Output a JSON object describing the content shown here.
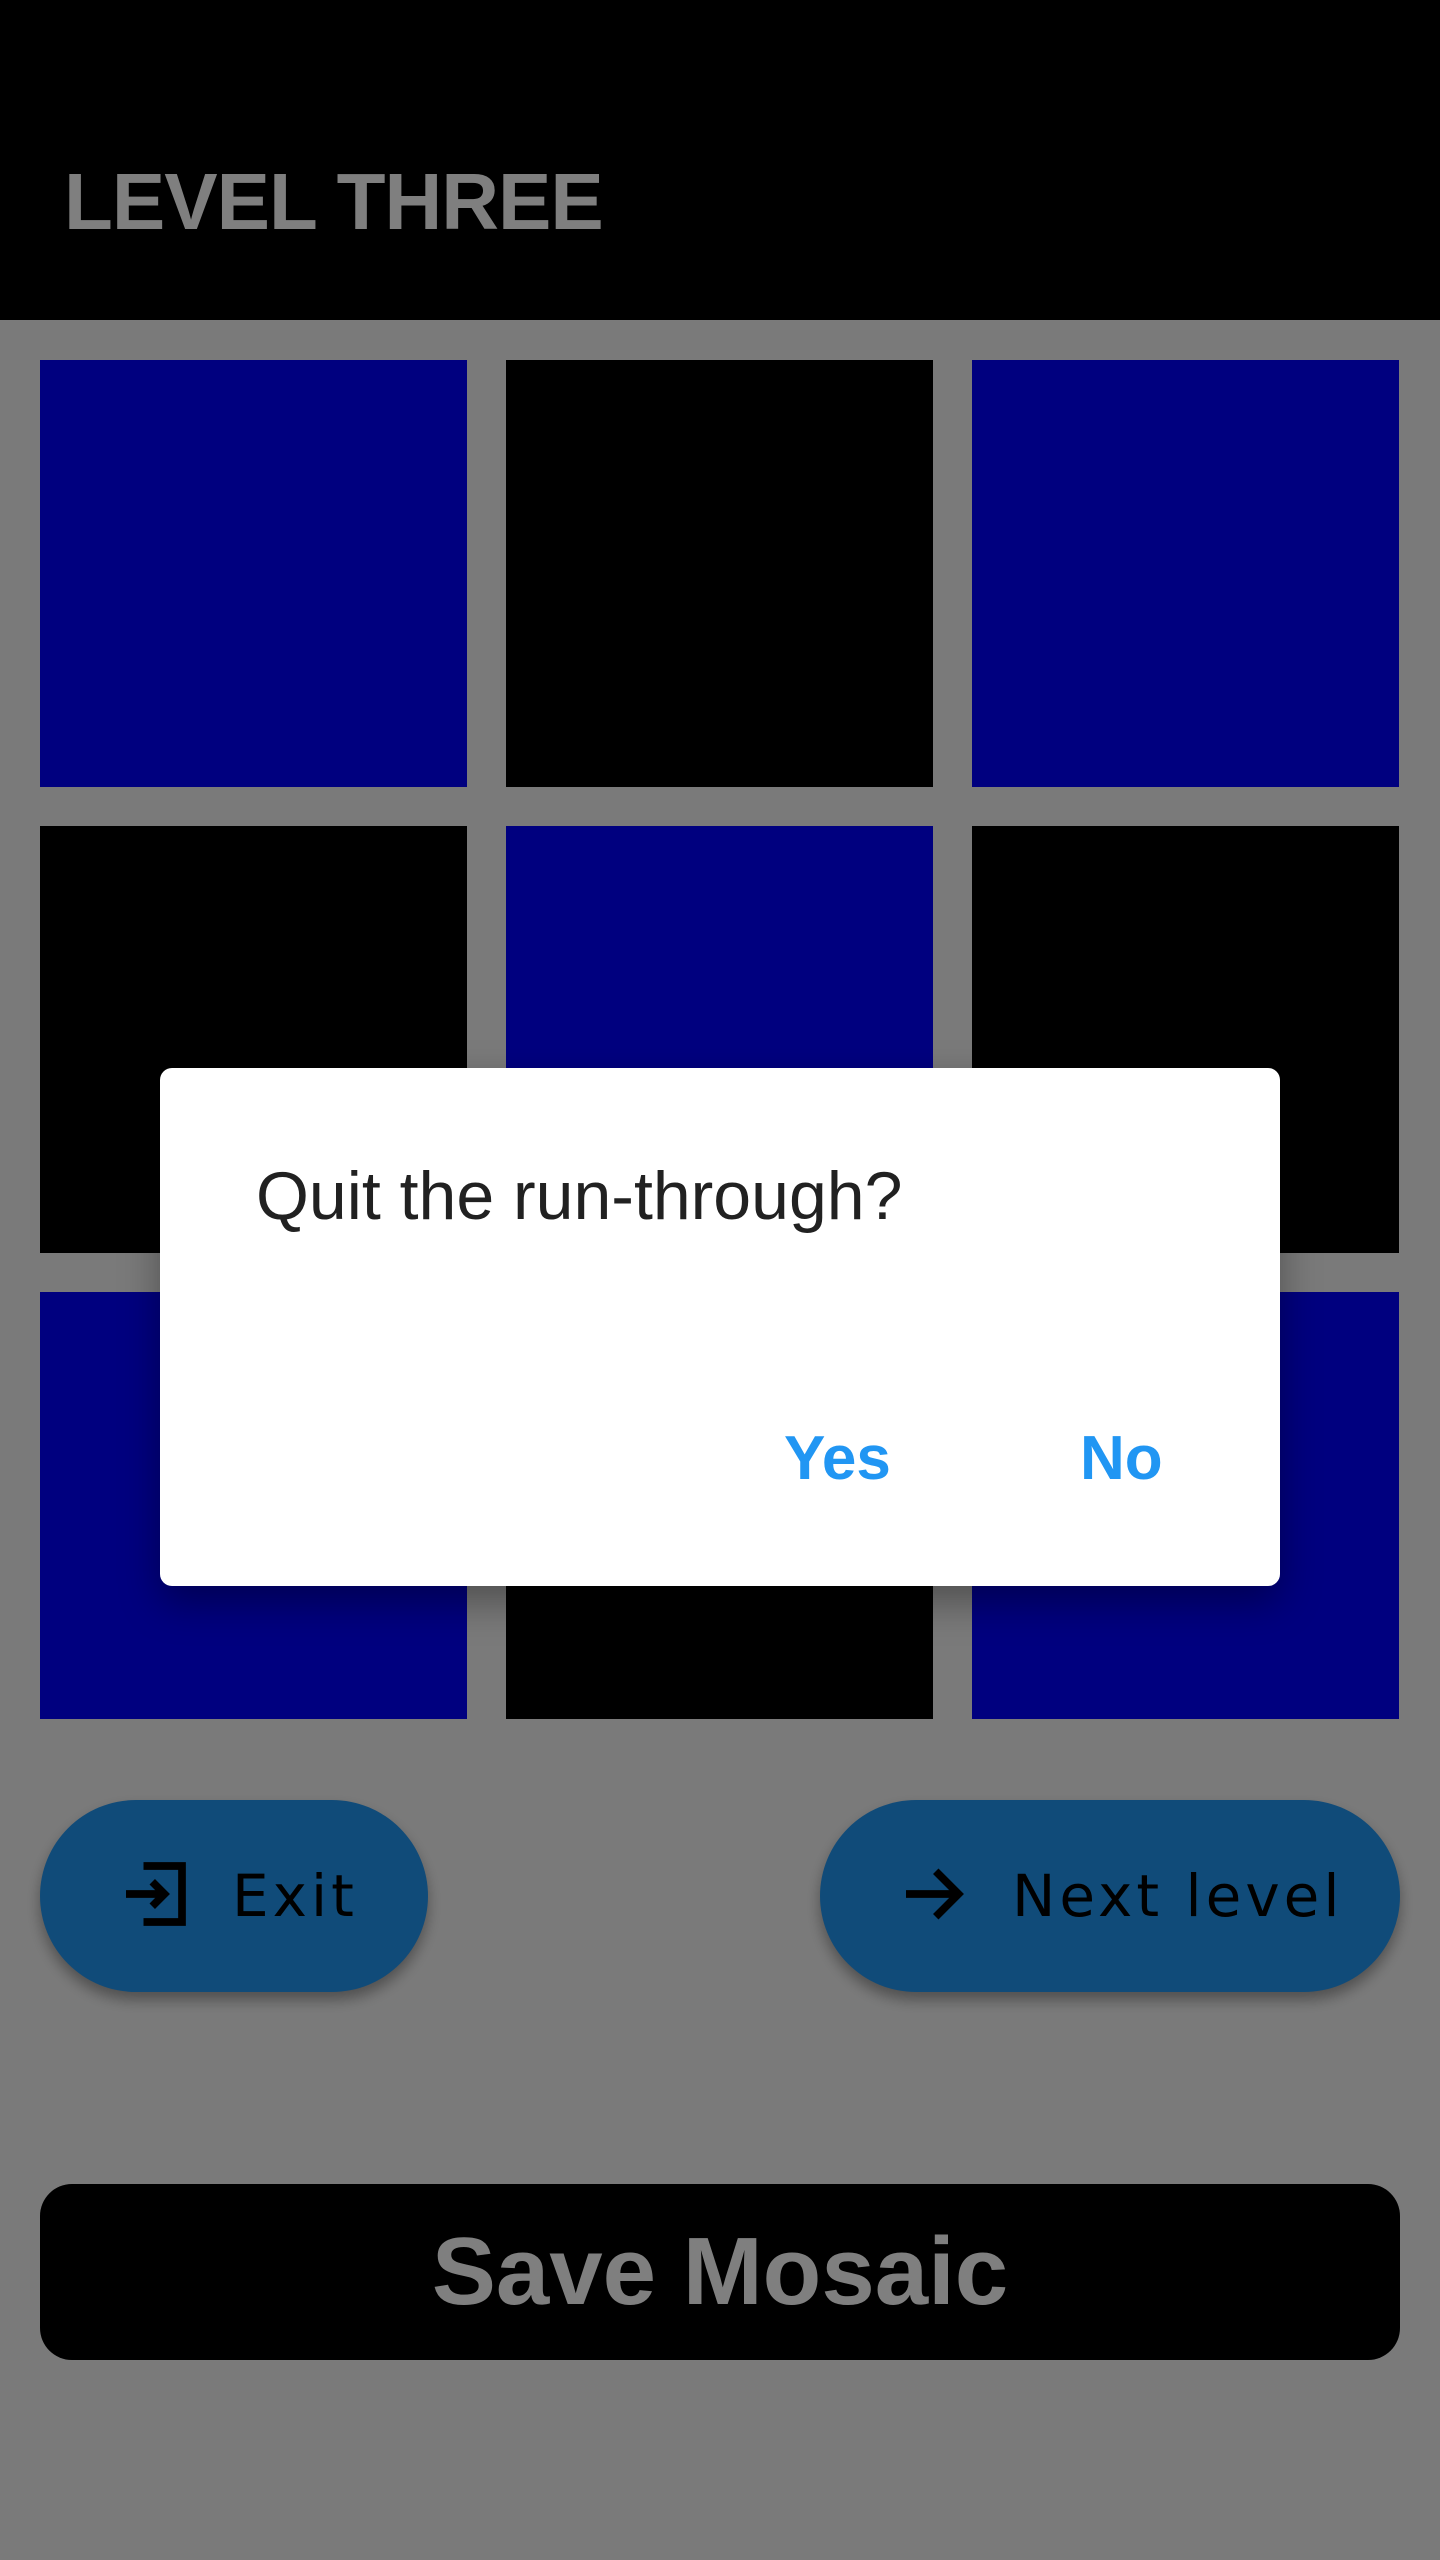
{
  "header": {
    "title": "LEVEL THREE"
  },
  "mosaic": {
    "rows": 3,
    "cols": 3,
    "tiles": [
      {
        "color": "#0000ff"
      },
      {
        "color": "#000000"
      },
      {
        "color": "#0000ff"
      },
      {
        "color": "#000000"
      },
      {
        "color": "#0000ff"
      },
      {
        "color": "#000000"
      },
      {
        "color": "#0000ff"
      },
      {
        "color": "#000000"
      },
      {
        "color": "#0000ff"
      }
    ]
  },
  "actions": {
    "exit_label": "Exit",
    "exit_icon": "exit-icon",
    "next_label": "Next level",
    "next_icon": "arrow-right-icon"
  },
  "save": {
    "label": "Save Mosaic"
  },
  "dialog": {
    "title": "Quit the run-through?",
    "yes_label": "Yes",
    "no_label": "No"
  },
  "colors": {
    "accent": "#2196f3",
    "tile_blue": "#0000ff",
    "tile_black": "#000000",
    "scrim": "rgba(0,0,0,0.5)"
  }
}
